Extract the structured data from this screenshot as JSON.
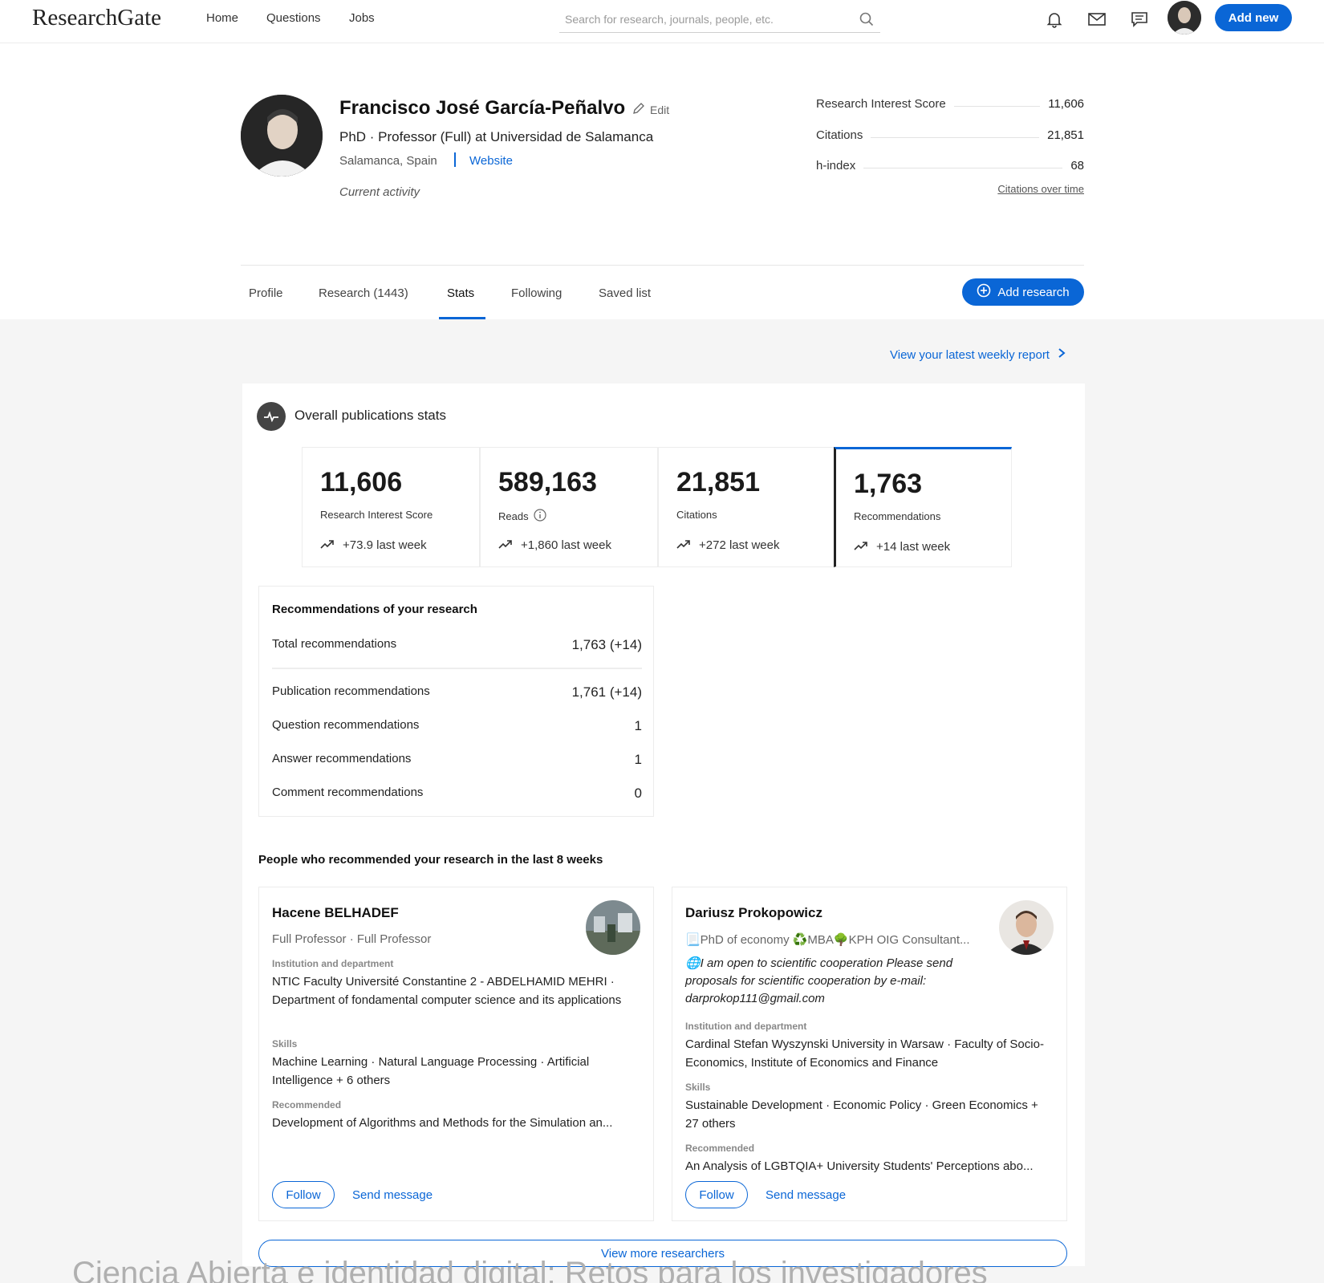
{
  "topbar": {
    "logo": "ResearchGate",
    "nav": [
      "Home",
      "Questions",
      "Jobs"
    ],
    "search_placeholder": "Search for research, journals, people, etc.",
    "add_new": "Add new"
  },
  "profile": {
    "name": "Francisco José García-Peñalvo",
    "edit": "Edit",
    "title": "PhD · Professor (Full) at Universidad de Salamanca",
    "location": "Salamanca, Spain",
    "website": "Website",
    "current_activity": "Current activity",
    "metrics": [
      {
        "label": "Research Interest Score",
        "value": "11,606"
      },
      {
        "label": "Citations",
        "value": "21,851"
      },
      {
        "label": "h-index",
        "value": "68"
      }
    ],
    "citations_link": "Citations over time"
  },
  "tabs": {
    "items": [
      "Profile",
      "Research (1443)",
      "Stats",
      "Following",
      "Saved list"
    ],
    "active": "Stats",
    "add_research": "Add research"
  },
  "stats": {
    "weekly_report": "View your latest weekly report",
    "overall_title": "Overall publications stats",
    "cards": [
      {
        "number": "11,606",
        "label": "Research Interest Score",
        "delta": "+73.9 last week"
      },
      {
        "number": "589,163",
        "label": "Reads",
        "delta": "+1,860 last week"
      },
      {
        "number": "21,851",
        "label": "Citations",
        "delta": "+272 last week"
      },
      {
        "number": "1,763",
        "label": "Recommendations",
        "delta": "+14 last week"
      }
    ]
  },
  "recommendations": {
    "title": "Recommendations of your research",
    "rows": [
      {
        "label": "Total recommendations",
        "value": "1,763 (+14)"
      },
      {
        "label": "Publication recommendations",
        "value": "1,761 (+14)"
      },
      {
        "label": "Question recommendations",
        "value": "1"
      },
      {
        "label": "Answer recommendations",
        "value": "1"
      },
      {
        "label": "Comment recommendations",
        "value": "0"
      }
    ]
  },
  "people": {
    "title": "People who recommended your research in the last 8 weeks",
    "section_labels": {
      "institution": "Institution and department",
      "skills": "Skills",
      "recommended": "Recommended"
    },
    "follow": "Follow",
    "send_message": "Send message",
    "list": [
      {
        "name": "Hacene BELHADEF",
        "subtitle": "Full Professor · Full Professor",
        "institution": "NTIC Faculty Université Constantine 2 - ABDELHAMID MEHRI · Department of fondamental computer science and its applications",
        "skills": "Machine Learning · Natural Language Processing · Artificial Intelligence + 6 others",
        "recommended": "Development of Algorithms and Methods for the Simulation an..."
      },
      {
        "name": "Dariusz Prokopowicz",
        "subtitle": "📃PhD of economy ♻️MBA🌳KPH OIG Consultant...",
        "quote": "🌐I am open to scientific cooperation Please send proposals for scientific cooperation by e-mail: darprokop111@gmail.com",
        "institution": "Cardinal Stefan Wyszynski University in Warsaw · Faculty of Socio-Economics, Institute of Economics and Finance",
        "skills": "Sustainable Development · Economic Policy · Green Economics + 27 others",
        "recommended": "An Analysis of LGBTQIA+ University Students' Perceptions abo..."
      }
    ],
    "view_more": "View more researchers"
  },
  "caption": "Ciencia Abierta e identidad digital: Retos para los investigadores",
  "colors": {
    "accent": "#0a66d6",
    "gray_bg": "#f5f5f5"
  }
}
